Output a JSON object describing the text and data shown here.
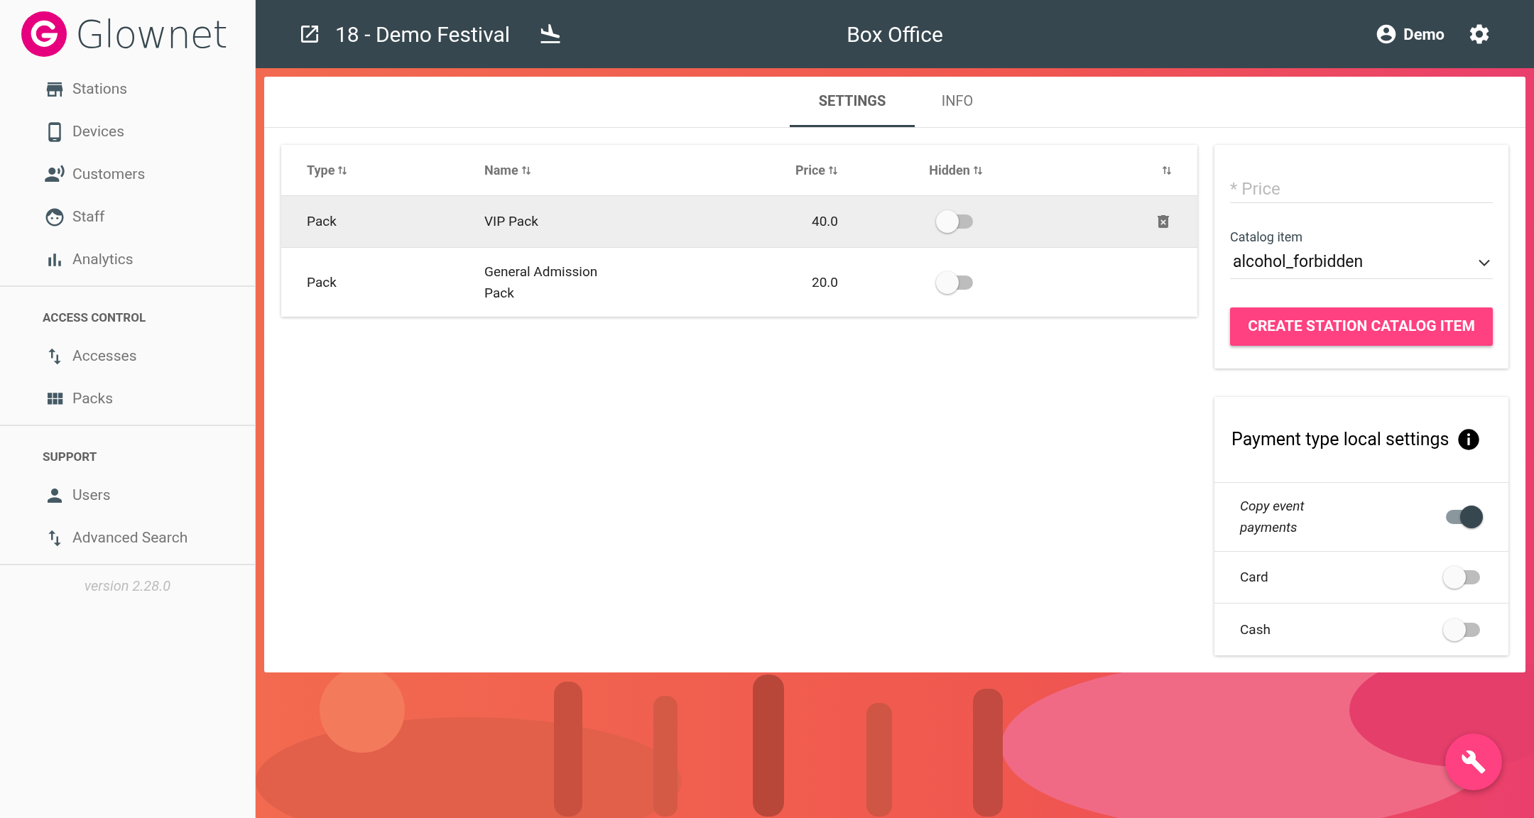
{
  "sidebar": {
    "logo": "Glownet",
    "sections": [
      {
        "items": [
          {
            "label": "Stations"
          },
          {
            "label": "Devices"
          },
          {
            "label": "Customers"
          },
          {
            "label": "Staff"
          },
          {
            "label": "Analytics"
          }
        ]
      },
      {
        "heading": "ACCESS CONTROL",
        "items": [
          {
            "label": "Accesses"
          },
          {
            "label": "Packs"
          }
        ]
      },
      {
        "heading": "SUPPORT",
        "items": [
          {
            "label": "Users"
          },
          {
            "label": "Advanced Search"
          }
        ]
      }
    ],
    "version": "version 2.28.0"
  },
  "header": {
    "event": "18 - Demo Festival",
    "title": "Box Office",
    "user": "Demo"
  },
  "tabs": [
    {
      "label": "SETTINGS",
      "selected": true
    },
    {
      "label": "INFO",
      "selected": false
    }
  ],
  "table": {
    "columns": [
      {
        "label": "Type"
      },
      {
        "label": "Name"
      },
      {
        "label": "Price"
      },
      {
        "label": "Hidden"
      },
      {}
    ],
    "rows": [
      {
        "type": "Pack",
        "name": "VIP Pack",
        "price": "40.0",
        "hidden": false,
        "selected": true
      },
      {
        "type": "Pack",
        "name": "General Admission Pack",
        "price": "20.0",
        "hidden": false,
        "selected": false
      }
    ]
  },
  "form": {
    "price_placeholder": "* Price",
    "catalog_label": "Catalog item",
    "catalog_value": "alcohol_forbidden",
    "button": "CREATE STATION CATALOG ITEM"
  },
  "payment_settings": {
    "title": "Payment type local settings",
    "items": [
      {
        "label": "Copy event payments",
        "on": true,
        "italic": true
      },
      {
        "label": "Card",
        "on": false,
        "italic": false
      },
      {
        "label": "Cash",
        "on": false,
        "italic": false
      }
    ]
  }
}
